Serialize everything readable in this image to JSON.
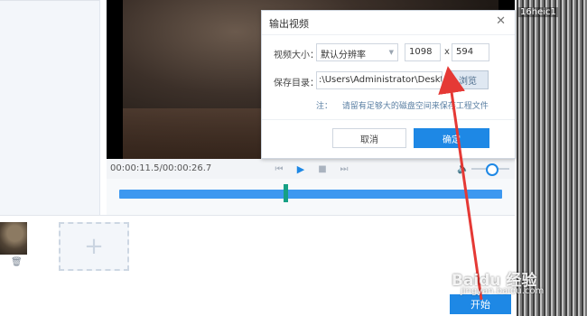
{
  "player": {
    "time_display": "00:00:11.5/00:00:26.7"
  },
  "right_image": {
    "caption": "16heic1"
  },
  "toolbar": {
    "start_label": "开始"
  },
  "dialog": {
    "title": "输出视频",
    "size_label": "视频大小：",
    "resolution_value": "默认分辨率",
    "width_value": "1098",
    "x_separator": "x",
    "height_value": "594",
    "save_dir_label": "保存目录：",
    "save_path_value": ":\\Users\\Administrator\\Desktop",
    "browse_label": "浏览",
    "note_prefix": "注：",
    "note_text": "请留有足够大的磁盘空间来保存工程文件",
    "cancel_label": "取消",
    "ok_label": "确定"
  },
  "watermark": {
    "main": "Baidu 经验",
    "sub": "jingyan.baidu.com"
  },
  "colors": {
    "accent": "#1e88e5",
    "timeline": "#3d98f0",
    "marker": "#16a085",
    "arrow": "#e53935"
  }
}
